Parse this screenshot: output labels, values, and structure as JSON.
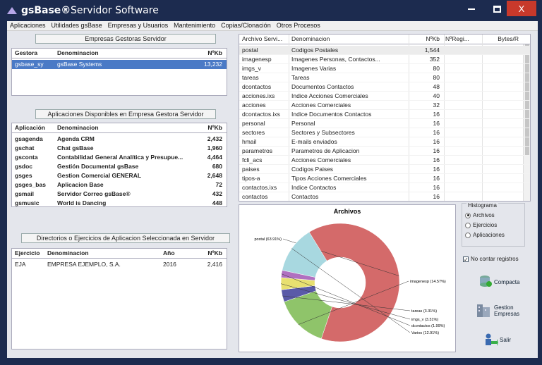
{
  "window": {
    "app": "gsBase®",
    "title": "Servidor Software",
    "close": "X"
  },
  "menu": [
    "Aplicaciones",
    "Utilidades gsBase",
    "Empresas y Usuarios",
    "Mantenimiento",
    "Copias/Clonación",
    "Otros Procesos"
  ],
  "empresas": {
    "title": "Empresas Gestoras Servidor",
    "headers": [
      "Gestora",
      "Denominacion",
      "NºKb"
    ],
    "rows": [
      [
        "gsbase_sy",
        "gsBase Systems",
        "13,232"
      ]
    ]
  },
  "aplicaciones": {
    "title": "Aplicaciones Disponibles en Empresa Gestora Servidor",
    "headers": [
      "Aplicación",
      "Denominacion",
      "NºKb"
    ],
    "rows": [
      [
        "gsagenda",
        "Agenda CRM",
        "2,432"
      ],
      [
        "gschat",
        "Chat gsBase",
        "1,960"
      ],
      [
        "gsconta",
        "Contabilidad General Analítica y Presupue...",
        "4,464"
      ],
      [
        "gsdoc",
        "Gestión Documental gsBase",
        "680"
      ],
      [
        "gsges",
        "Gestion Comercial GENERAL",
        "2,648"
      ],
      [
        "gsges_bas",
        "Aplicacion Base",
        "72"
      ],
      [
        "gsmail",
        "Servidor Correo gsBase®",
        "432"
      ],
      [
        "gsmusic",
        "World is Dancing",
        "448"
      ]
    ]
  },
  "directorios": {
    "title": "Directorios o Ejercicios de Aplicacion Seleccionada en Servidor",
    "headers": [
      "Ejercicio",
      "Denominacion",
      "Año",
      "NºKb"
    ],
    "rows": [
      [
        "EJA",
        "EMPRESA EJEMPLO, S.A.",
        "2016",
        "2,416"
      ]
    ]
  },
  "archivos": {
    "headers": [
      "Archivo Servi...",
      "Denominacion",
      "NºKb",
      "NºRegi...",
      "Bytes/R"
    ],
    "rows": [
      [
        "postal",
        "Codigos Postales",
        "1,544"
      ],
      [
        "imagenesp",
        "Imagenes Personas, Contactos...",
        "352"
      ],
      [
        "imgs_v",
        "Imagenes Varias",
        "80"
      ],
      [
        "tareas",
        "Tareas",
        "80"
      ],
      [
        "dcontactos",
        "Documentos Contactos",
        "48"
      ],
      [
        "acciones.ixs",
        "Indice Acciones Comerciales",
        "40"
      ],
      [
        "acciones",
        "Acciones Comerciales",
        "32"
      ],
      [
        "dcontactos.ixs",
        "Indice Documentos Contactos",
        "16"
      ],
      [
        "personal",
        "Personal",
        "16"
      ],
      [
        "sectores",
        "Sectores y Subsectores",
        "16"
      ],
      [
        "hmail",
        "E-mails enviados",
        "16"
      ],
      [
        "parametros",
        "Parametros de Aplicacion",
        "16"
      ],
      [
        "fcli_acs",
        "Acciones Comerciales",
        "16"
      ],
      [
        "paises",
        "Codigos Paises",
        "16"
      ],
      [
        "tipos-a",
        "Tipos Acciones Comerciales",
        "16"
      ],
      [
        "contactos.ixs",
        "Indice Contactos",
        "16"
      ],
      [
        "contactos",
        "Contactos",
        "16"
      ]
    ]
  },
  "chart_data": {
    "type": "pie",
    "title": "Archivos",
    "slices": [
      {
        "label": "postal (63.91%)",
        "value": 63.91,
        "color": "#d46a6a"
      },
      {
        "label": "imagenesp (14.57%)",
        "value": 14.57,
        "color": "#8fc46a"
      },
      {
        "label": "tareas (3.31%)",
        "value": 3.31,
        "color": "#5a5aa8"
      },
      {
        "label": "imgs_v (3.31%)",
        "value": 3.31,
        "color": "#e8e070"
      },
      {
        "label": "dcontactos (1.99%)",
        "value": 1.99,
        "color": "#b070c0"
      },
      {
        "label": "Varios (12.91%)",
        "value": 12.91,
        "color": "#a8d8e0"
      }
    ]
  },
  "side": {
    "histograma_title": "Histograma",
    "options": [
      {
        "label": "Archivos",
        "checked": true
      },
      {
        "label": "Ejercicios",
        "checked": false
      },
      {
        "label": "Aplicaciones",
        "checked": false
      }
    ],
    "no_contar": "No contar registros",
    "compacta": "Compacta",
    "gestion1": "Gestion",
    "gestion2": "Empresas",
    "salir": "Salir"
  }
}
